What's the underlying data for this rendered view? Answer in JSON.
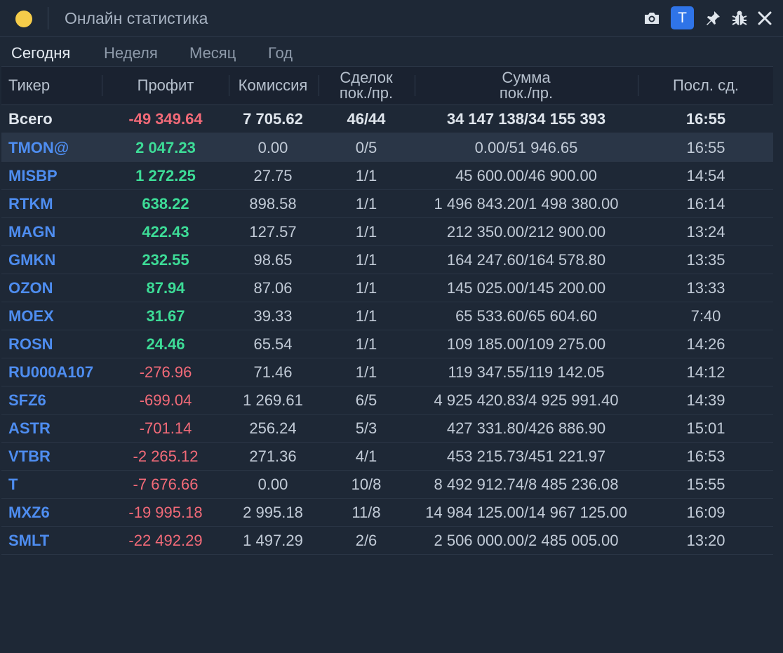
{
  "window": {
    "title": "Онлайн статистика",
    "badge": "T"
  },
  "tabs": [
    "Сегодня",
    "Неделя",
    "Месяц",
    "Год"
  ],
  "columns": [
    "Тикер",
    "Профит",
    "Комиссия",
    "Сделок\nпок./пр.",
    "Сумма\nпок./пр.",
    "Посл. сд."
  ],
  "total": {
    "label": "Всего",
    "profit": "-49 349.64",
    "commission": "7 705.62",
    "deals": "46/44",
    "sum": "34 147 138/34 155 393",
    "last": "16:55"
  },
  "rows": [
    {
      "ticker": "TMON@",
      "profit": "2 047.23",
      "commission": "0.00",
      "deals": "0/5",
      "sum": "0.00/51 946.65",
      "last": "16:55",
      "sign": "pos"
    },
    {
      "ticker": "MISBP",
      "profit": "1 272.25",
      "commission": "27.75",
      "deals": "1/1",
      "sum": "45 600.00/46 900.00",
      "last": "14:54",
      "sign": "pos"
    },
    {
      "ticker": "RTKM",
      "profit": "638.22",
      "commission": "898.58",
      "deals": "1/1",
      "sum": "1 496 843.20/1 498 380.00",
      "last": "16:14",
      "sign": "pos"
    },
    {
      "ticker": "MAGN",
      "profit": "422.43",
      "commission": "127.57",
      "deals": "1/1",
      "sum": "212 350.00/212 900.00",
      "last": "13:24",
      "sign": "pos"
    },
    {
      "ticker": "GMKN",
      "profit": "232.55",
      "commission": "98.65",
      "deals": "1/1",
      "sum": "164 247.60/164 578.80",
      "last": "13:35",
      "sign": "pos"
    },
    {
      "ticker": "OZON",
      "profit": "87.94",
      "commission": "87.06",
      "deals": "1/1",
      "sum": "145 025.00/145 200.00",
      "last": "13:33",
      "sign": "pos"
    },
    {
      "ticker": "MOEX",
      "profit": "31.67",
      "commission": "39.33",
      "deals": "1/1",
      "sum": "65 533.60/65 604.60",
      "last": "7:40",
      "sign": "pos"
    },
    {
      "ticker": "ROSN",
      "profit": "24.46",
      "commission": "65.54",
      "deals": "1/1",
      "sum": "109 185.00/109 275.00",
      "last": "14:26",
      "sign": "pos"
    },
    {
      "ticker": "RU000A107",
      "profit": "-276.96",
      "commission": "71.46",
      "deals": "1/1",
      "sum": "119 347.55/119 142.05",
      "last": "14:12",
      "sign": "neg"
    },
    {
      "ticker": "SFZ6",
      "profit": "-699.04",
      "commission": "1 269.61",
      "deals": "6/5",
      "sum": "4 925 420.83/4 925 991.40",
      "last": "14:39",
      "sign": "neg"
    },
    {
      "ticker": "ASTR",
      "profit": "-701.14",
      "commission": "256.24",
      "deals": "5/3",
      "sum": "427 331.80/426 886.90",
      "last": "15:01",
      "sign": "neg"
    },
    {
      "ticker": "VTBR",
      "profit": "-2 265.12",
      "commission": "271.36",
      "deals": "4/1",
      "sum": "453 215.73/451 221.97",
      "last": "16:53",
      "sign": "neg"
    },
    {
      "ticker": "T",
      "profit": "-7 676.66",
      "commission": "0.00",
      "deals": "10/8",
      "sum": "8 492 912.74/8 485 236.08",
      "last": "15:55",
      "sign": "neg"
    },
    {
      "ticker": "MXZ6",
      "profit": "-19 995.18",
      "commission": "2 995.18",
      "deals": "11/8",
      "sum": "14 984 125.00/14 967 125.00",
      "last": "16:09",
      "sign": "neg"
    },
    {
      "ticker": "SMLT",
      "profit": "-22 492.29",
      "commission": "1 497.29",
      "deals": "2/6",
      "sum": "2 506 000.00/2 485 005.00",
      "last": "13:20",
      "sign": "neg"
    }
  ],
  "colors": {
    "background": "#1e2836",
    "ticker": "#4e8df0",
    "positive": "#3ddc97",
    "negative": "#f26a78",
    "badge": "#2f74e8",
    "dot": "#f5cc4a"
  }
}
